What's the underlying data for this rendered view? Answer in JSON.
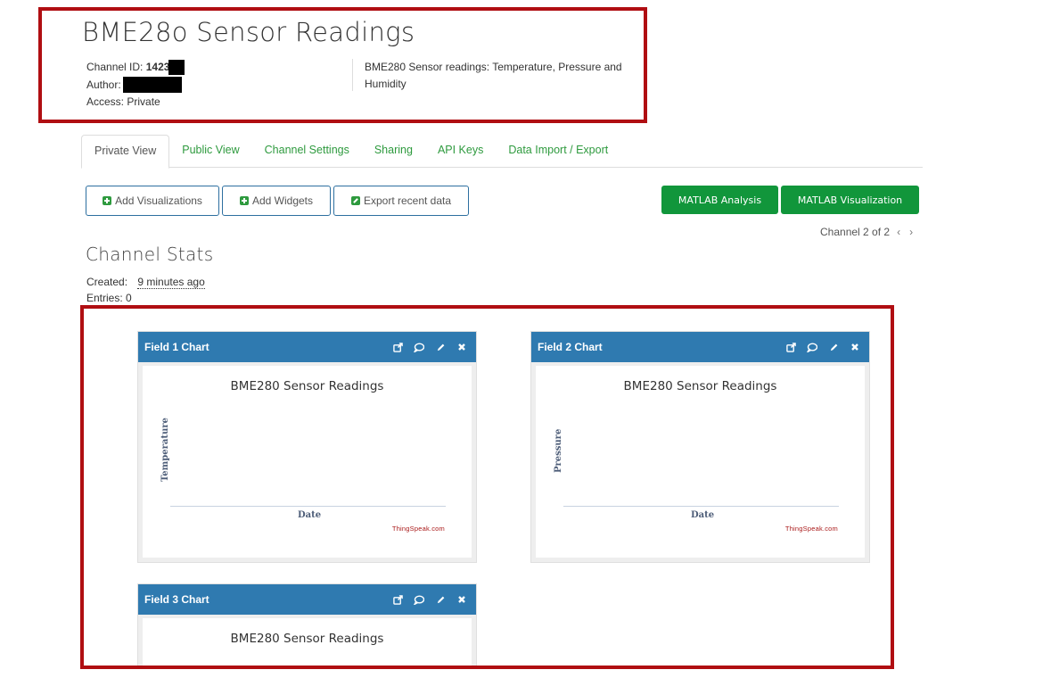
{
  "header": {
    "title": "BME28o Sensor Readings",
    "channel_id_label": "Channel ID:",
    "channel_id_value": "1423",
    "author_label": "Author:",
    "access_label": "Access:",
    "access_value": "Private",
    "description": "BME280 Sensor readings: Temperature, Pressure and Humidity"
  },
  "tabs": [
    {
      "label": "Private View",
      "active": true
    },
    {
      "label": "Public View"
    },
    {
      "label": "Channel Settings"
    },
    {
      "label": "Sharing"
    },
    {
      "label": "API Keys"
    },
    {
      "label": "Data Import / Export"
    }
  ],
  "toolbar": {
    "add_visualizations": "Add Visualizations",
    "add_widgets": "Add Widgets",
    "export_recent": "Export recent data",
    "matlab_analysis": "MATLAB Analysis",
    "matlab_visualization": "MATLAB Visualization"
  },
  "pager": {
    "text": "Channel 2 of 2",
    "prev": "‹",
    "next": "›"
  },
  "stats": {
    "title": "Channel Stats",
    "created_label": "Created:",
    "created_value": "9 minutes ago",
    "entries_label": "Entries:",
    "entries_value": "0"
  },
  "charts": [
    {
      "panel_title": "Field 1 Chart",
      "title": "BME280 Sensor Readings",
      "ylabel": "Temperature",
      "xlabel": "Date",
      "credit": "ThingSpeak.com"
    },
    {
      "panel_title": "Field 2 Chart",
      "title": "BME280 Sensor Readings",
      "ylabel": "Pressure",
      "xlabel": "Date",
      "credit": "ThingSpeak.com"
    },
    {
      "panel_title": "Field 3 Chart",
      "title": "BME280 Sensor Readings"
    }
  ],
  "icons": {
    "open": "external-link-icon",
    "comment": "comment-icon",
    "edit": "pencil-icon",
    "close": "close-icon"
  },
  "colors": {
    "accent_green": "#11963b",
    "tab_green": "#2e9a3e",
    "panel_blue": "#2f7ab0",
    "highlight_red": "#b00e12",
    "credit_red": "#aa1a1a"
  }
}
